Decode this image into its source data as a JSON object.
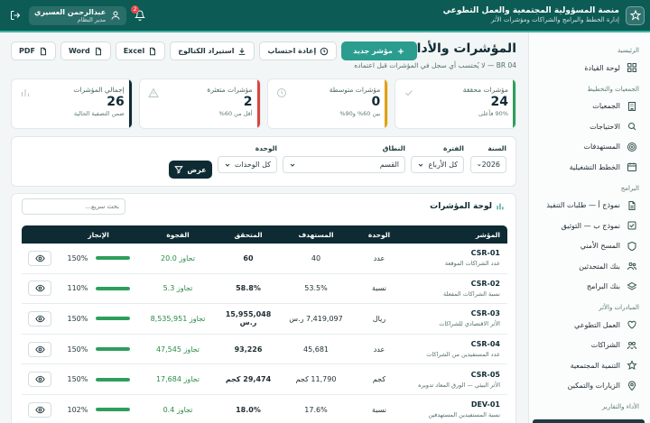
{
  "topbar": {
    "title": "منصة المسؤولية المجتمعية والعمل التطوعي",
    "subtitle": "إدارة الخطط والبرامج والشراكات ومؤشرات الأثر",
    "user_name": "عبدالرحمن العسيري",
    "user_role": "مدير النظام",
    "notifications": "2"
  },
  "sidebar": {
    "sections": [
      {
        "title": "الرئيسية",
        "items": [
          {
            "label": "لوحة القيادة",
            "icon": "dashboard-icon"
          }
        ]
      },
      {
        "title": "الجمعيات والتخطيط",
        "items": [
          {
            "label": "الجمعيات",
            "icon": "building-icon"
          },
          {
            "label": "الاحتياجات",
            "icon": "search-icon"
          },
          {
            "label": "المستهدفات",
            "icon": "target-icon"
          },
          {
            "label": "الخطط التشغيلية",
            "icon": "calendar-icon"
          }
        ]
      },
      {
        "title": "البرامج",
        "items": [
          {
            "label": "نموذج أ — طلبات التنفيذ",
            "icon": "document-icon"
          },
          {
            "label": "نموذج ب — التوثيق",
            "icon": "checklist-icon"
          },
          {
            "label": "المسح الأمني",
            "icon": "shield-icon"
          },
          {
            "label": "بنك المتحدثين",
            "icon": "users-icon"
          },
          {
            "label": "بنك البرامج",
            "icon": "stack-icon"
          }
        ]
      },
      {
        "title": "المبادرات والأثر",
        "items": [
          {
            "label": "العمل التطوعي",
            "icon": "heart-icon"
          },
          {
            "label": "الشراكات",
            "icon": "handshake-icon"
          },
          {
            "label": "التنمية المجتمعية",
            "icon": "star-icon"
          },
          {
            "label": "الزيارات والتمكين",
            "icon": "pin-icon"
          }
        ]
      },
      {
        "title": "الأداء والتقارير",
        "items": []
      }
    ]
  },
  "header": {
    "title": "المؤشرات والأداء",
    "subtitle": "BR 04 — لا يُحتسب أي سجل في المؤشرات قبل اعتماده",
    "new_label": "مؤشر جديد",
    "recalc_label": "إعادة احتساب",
    "import_label": "استيراد الكتالوج",
    "excel_label": "Excel",
    "word_label": "Word",
    "pdf_label": "PDF"
  },
  "kpis": [
    {
      "label": "مؤشرات محققة",
      "value": "24",
      "hint": "90% فأعلى",
      "color": "#2e9e5b",
      "icon": "check-icon"
    },
    {
      "label": "مؤشرات متوسطة",
      "value": "0",
      "hint": "بين 60% و90%",
      "color": "#e3a008",
      "icon": "clock-icon"
    },
    {
      "label": "مؤشرات متعثرة",
      "value": "2",
      "hint": "أقل من 60%",
      "color": "#d9453f",
      "icon": "warning-icon"
    },
    {
      "label": "إجمالي المؤشرات",
      "value": "26",
      "hint": "ضمن التصفية الحالية",
      "color": "#0e2b33",
      "icon": "chart-icon"
    }
  ],
  "filters": {
    "year_label": "السنة",
    "year_value": "2026",
    "period_label": "الفترة",
    "period_value": "كل الأرباع",
    "scope_label": "النطاق",
    "scope_value": "القسم",
    "unit_label": "الوحدة",
    "unit_value": "كل الوحدات",
    "show_label": "عرض"
  },
  "board": {
    "title": "لوحة المؤشرات",
    "search_placeholder": "بحث سريع...",
    "columns": {
      "indicator": "المؤشر",
      "unit": "الوحدة",
      "target": "المستهدف",
      "actual": "المتحقق",
      "gap": "الفجوة",
      "achievement": "الإنجاز"
    },
    "rows": [
      {
        "code": "CSR-01",
        "name": "عدد الشراكات الموقعة",
        "unit": "عدد",
        "target": "40",
        "actual": "60",
        "gap": "تجاوز 20.0",
        "pct": "150%",
        "ratio": 1.0
      },
      {
        "code": "CSR-02",
        "name": "نسبة الشراكات المفعلة",
        "unit": "نسبة",
        "target": "53.5%",
        "actual": "58.8%",
        "gap": "تجاوز 5.3",
        "pct": "110%",
        "ratio": 1.0
      },
      {
        "code": "CSR-03",
        "name": "الأثر الاقتصادي للشراكات",
        "unit": "ريال",
        "target": "7,419,097 ر.س",
        "actual": "15,955,048 ر.س",
        "gap": "تجاوز 8,535,951",
        "pct": "150%",
        "ratio": 1.0
      },
      {
        "code": "CSR-04",
        "name": "عدد المستفيدين من الشراكات",
        "unit": "عدد",
        "target": "45,681",
        "actual": "93,226",
        "gap": "تجاوز 47,545",
        "pct": "150%",
        "ratio": 1.0
      },
      {
        "code": "CSR-05",
        "name": "الأثر البيئي — الورق المعاد تدويره",
        "unit": "كجم",
        "target": "11,790 كجم",
        "actual": "29,474 كجم",
        "gap": "تجاوز 17,684",
        "pct": "150%",
        "ratio": 1.0
      },
      {
        "code": "DEV-01",
        "name": "نسبة المستفيدين المستهدفين",
        "unit": "نسبة",
        "target": "17.6%",
        "actual": "18.0%",
        "gap": "تجاوز 0.4",
        "pct": "102%",
        "ratio": 1.0
      }
    ]
  }
}
